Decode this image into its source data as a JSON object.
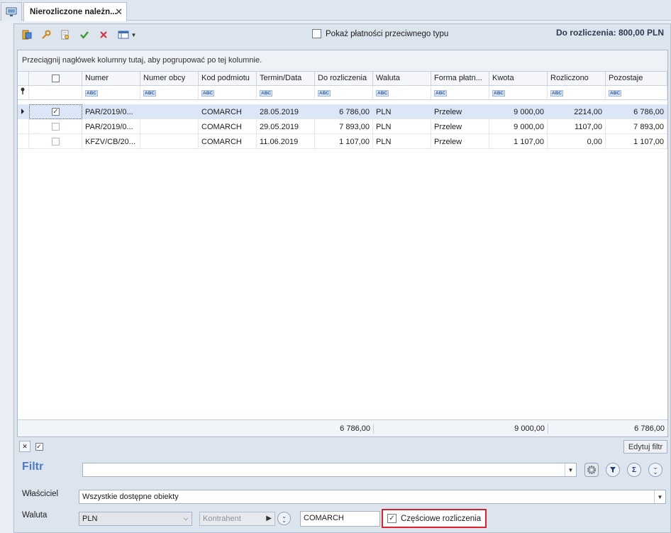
{
  "tab": {
    "title": "Nierozliczone należn...",
    "close": "✕"
  },
  "toolbar": {
    "opposite_payments_label": "Pokaż płatności przeciwnego typu",
    "to_settle_label": "Do rozliczenia: 800,00 PLN"
  },
  "grid": {
    "group_hint": "Przeciągnij nagłówek kolumny tutaj, aby pogrupować po tej kolumnie.",
    "columns": [
      "Numer",
      "Numer obcy",
      "Kod podmiotu",
      "Termin/Data",
      "Do rozliczenia",
      "Waluta",
      "Forma płatn...",
      "Kwota",
      "Rozliczono",
      "Pozostaje"
    ],
    "filter_icon": "ABC",
    "rows": [
      {
        "checked": true,
        "numer": "PAR/2019/0...",
        "numer_obcy": "",
        "kod": "COMARCH",
        "termin": "28.05.2019",
        "do_rozliczenia": "6 786,00",
        "waluta": "PLN",
        "forma": "Przelew",
        "kwota": "9 000,00",
        "rozliczono": "2214,00",
        "pozostaje": "6 786,00"
      },
      {
        "checked": false,
        "numer": "PAR/2019/0...",
        "numer_obcy": "",
        "kod": "COMARCH",
        "termin": "29.05.2019",
        "do_rozliczenia": "7 893,00",
        "waluta": "PLN",
        "forma": "Przelew",
        "kwota": "9 000,00",
        "rozliczono": "1107,00",
        "pozostaje": "7 893,00"
      },
      {
        "checked": false,
        "numer": "KFZV/CB/20...",
        "numer_obcy": "",
        "kod": "COMARCH",
        "termin": "11.06.2019",
        "do_rozliczenia": "1 107,00",
        "waluta": "PLN",
        "forma": "Przelew",
        "kwota": "1 107,00",
        "rozliczono": "0,00",
        "pozostaje": "1 107,00"
      }
    ],
    "totals": {
      "do_rozliczenia": "6 786,00",
      "kwota": "9 000,00",
      "pozostaje": "6 786,00"
    }
  },
  "bottom": {
    "edit_filter": "Edytuj filtr",
    "filter_label": "Filtr",
    "filter_value": "",
    "owner_label": "Właściciel",
    "owner_value": "Wszystkie dostępne obiekty",
    "currency_label": "Waluta",
    "currency_value": "PLN",
    "contractor_button": "Kontrahent",
    "contractor_value": "COMARCH",
    "partial_label": "Częściowe rozliczenia",
    "partial_checked": true
  },
  "colors": {
    "accent": "#4f7bc6",
    "highlight_border": "#e0202e",
    "selected_row": "#dbe7f7"
  }
}
